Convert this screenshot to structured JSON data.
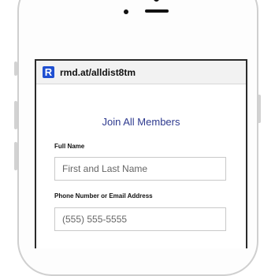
{
  "browser": {
    "url": "rmd.at/alldist8tm"
  },
  "form": {
    "title": "Join All Members",
    "full_name": {
      "label": "Full Name",
      "placeholder": "First and Last Name"
    },
    "contact": {
      "label": "Phone Number or Email Address",
      "placeholder": "(555) 555-5555"
    }
  },
  "icons": {
    "logo": "remind-logo",
    "logo_glyph": "R"
  },
  "colors": {
    "title": "#2e3a8f",
    "logo_bg": "#1f4fd1"
  }
}
